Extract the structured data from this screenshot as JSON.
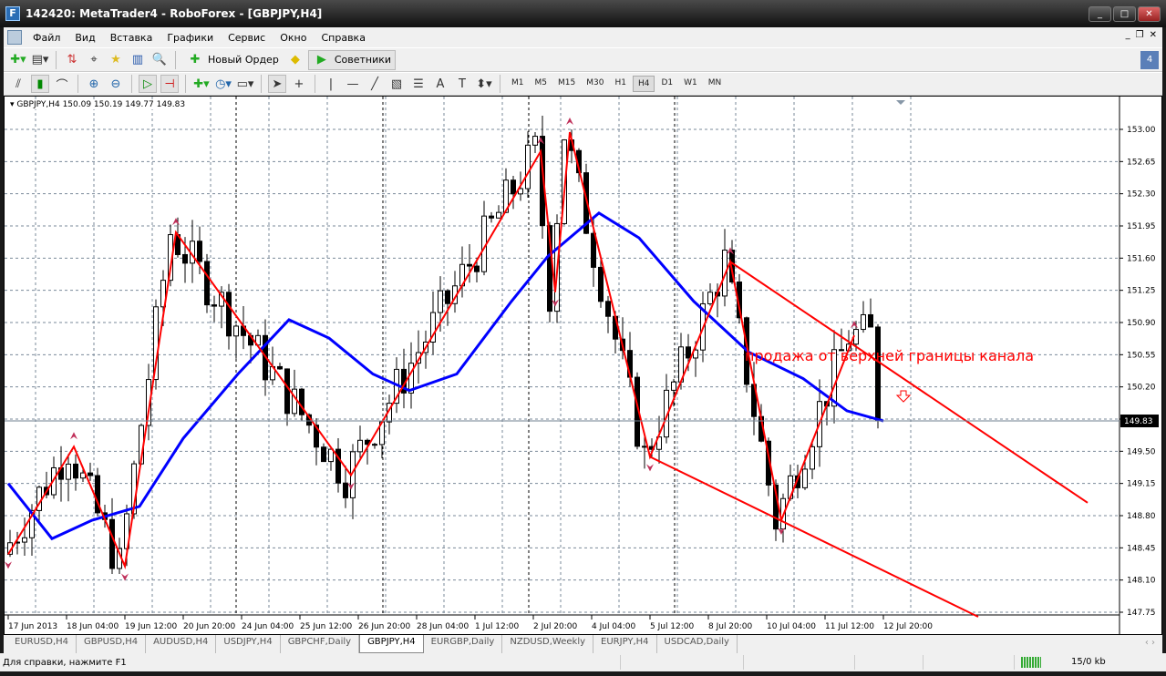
{
  "window": {
    "title": "142420: MetaTrader4 - RoboForex - [GBPJPY,H4]",
    "logo": "F"
  },
  "menu": [
    "Файл",
    "Вид",
    "Вставка",
    "Графики",
    "Сервис",
    "Окно",
    "Справка"
  ],
  "toolbar": {
    "new_order": "Новый Ордер",
    "experts": "Советники"
  },
  "timeframes": [
    "M1",
    "M5",
    "M15",
    "M30",
    "H1",
    "H4",
    "D1",
    "W1",
    "MN"
  ],
  "active_timeframe": "H4",
  "chart": {
    "symbol_line": "GBPJPY,H4  150.09 150.19 149.77 149.83",
    "annotation": "продажа от верхней границы канала",
    "current_price": "149.83",
    "colors": {
      "zigzag": "#ff0000",
      "ma": "#0000ff",
      "channel": "#ff0000",
      "annotation": "#ff0000"
    }
  },
  "chart_data": {
    "type": "candlestick",
    "symbol": "GBPJPY",
    "timeframe": "H4",
    "price_ticks": [
      "153.00",
      "152.65",
      "152.30",
      "151.95",
      "151.60",
      "151.25",
      "150.90",
      "150.55",
      "150.20",
      "149.85",
      "149.50",
      "149.15",
      "148.80",
      "148.45",
      "148.10",
      "147.75"
    ],
    "ylim": [
      147.75,
      153.0
    ],
    "time_ticks": [
      "17 Jun 2013",
      "18 Jun 04:00",
      "19 Jun 12:00",
      "20 Jun 20:00",
      "24 Jun 04:00",
      "25 Jun 12:00",
      "26 Jun 20:00",
      "28 Jun 04:00",
      "1 Jul 12:00",
      "2 Jul 20:00",
      "4 Jul 04:00",
      "5 Jul 12:00",
      "8 Jul 20:00",
      "10 Jul 04:00",
      "11 Jul 12:00",
      "12 Jul 20:00"
    ],
    "bars": 240,
    "last_ohlc": {
      "open": 150.09,
      "high": 150.19,
      "low": 149.77,
      "close": 149.83
    },
    "zigzag": [
      [
        0,
        148.38
      ],
      [
        18,
        149.55
      ],
      [
        32,
        148.25
      ],
      [
        46,
        151.88
      ],
      [
        94,
        149.24
      ],
      [
        146,
        152.76
      ],
      [
        150,
        151.23
      ],
      [
        154,
        152.97
      ],
      [
        176,
        149.44
      ],
      [
        198,
        151.56
      ],
      [
        212,
        148.75
      ],
      [
        232,
        150.76
      ]
    ],
    "moving_average": [
      [
        0,
        149.15
      ],
      [
        12,
        148.55
      ],
      [
        23,
        148.75
      ],
      [
        36,
        148.9
      ],
      [
        48,
        149.64
      ],
      [
        63,
        150.34
      ],
      [
        77,
        150.93
      ],
      [
        88,
        150.73
      ],
      [
        100,
        150.34
      ],
      [
        110,
        150.16
      ],
      [
        123,
        150.34
      ],
      [
        138,
        151.13
      ],
      [
        148,
        151.62
      ],
      [
        162,
        152.09
      ],
      [
        173,
        151.82
      ],
      [
        188,
        151.13
      ],
      [
        203,
        150.58
      ],
      [
        218,
        150.29
      ],
      [
        230,
        149.94
      ],
      [
        240,
        149.83
      ]
    ],
    "channel_upper": [
      [
        198,
        151.56
      ],
      [
        296,
        148.94
      ]
    ],
    "channel_lower": [
      [
        176,
        149.44
      ],
      [
        266,
        147.7
      ]
    ]
  },
  "tabs": [
    "EURUSD,H4",
    "GBPUSD,H4",
    "AUDUSD,H4",
    "USDJPY,H4",
    "GBPCHF,Daily",
    "GBPJPY,H4",
    "EURGBP,Daily",
    "NZDUSD,Weekly",
    "EURJPY,H4",
    "USDCAD,Daily"
  ],
  "active_tab": "GBPJPY,H4",
  "status": {
    "help": "Для справки, нажмите F1",
    "traffic": "15/0 kb"
  }
}
